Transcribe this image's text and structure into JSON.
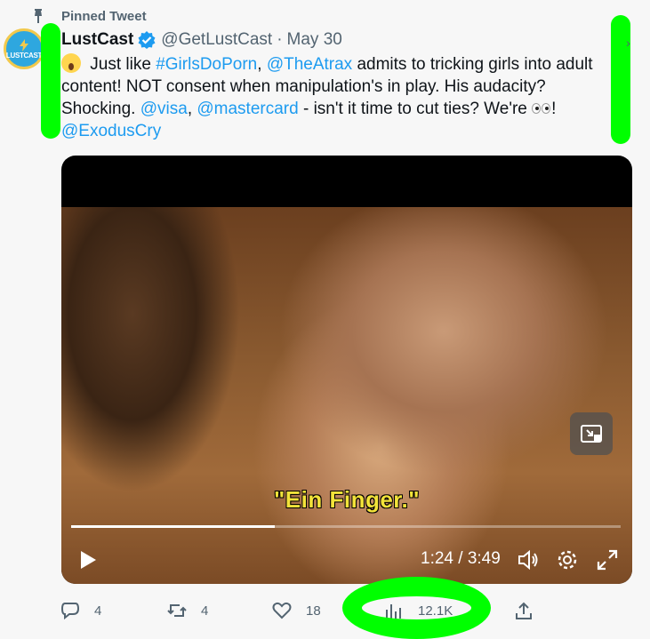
{
  "pinned": {
    "label": "Pinned Tweet"
  },
  "author": {
    "avatar_text": "LUSTCAST",
    "name": "LustCast",
    "handle": "@GetLustCast",
    "separator": "·",
    "date": "May 30"
  },
  "tweet": {
    "t1": " Just like ",
    "hashtag": "#GirlsDoPorn",
    "t2": ", ",
    "mention1": "@TheAtrax",
    "t3": " admits to tricking girls into adult content! NOT consent when manipulation's in play. His audacity? Shocking. ",
    "mention2": "@visa",
    "t4": ", ",
    "mention3": "@mastercard",
    "t5": " - isn't it time to cut ties? We're ",
    "t6": "!",
    "mention4": "@ExodusCry"
  },
  "video": {
    "subtitle": "\"Ein Finger.\"",
    "time": "1:24 / 3:49",
    "progress": 0.37
  },
  "actions": {
    "replies": "4",
    "retweets": "4",
    "likes": "18",
    "views": "12.1K"
  },
  "colors": {
    "link": "#1d9bf0",
    "annotation": "#00ff00",
    "muted": "#536471"
  }
}
